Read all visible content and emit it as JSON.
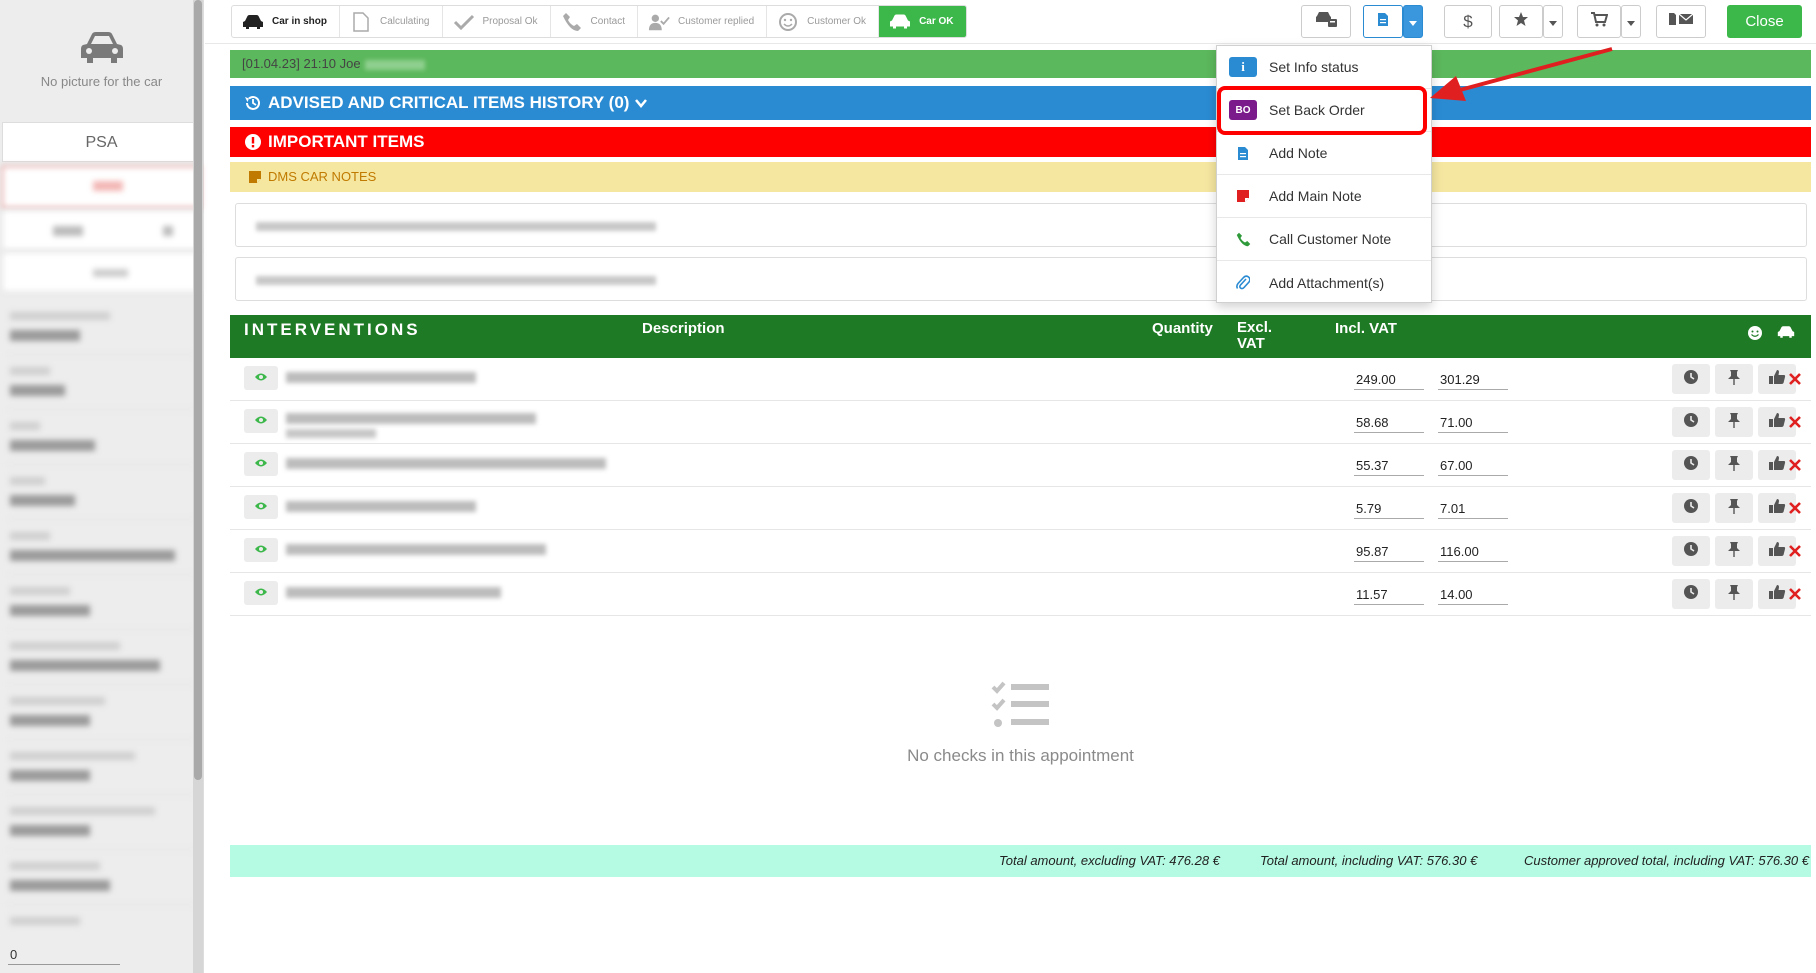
{
  "sidebar": {
    "no_picture_label": "No picture for the car",
    "brand": "PSA",
    "bottom_value": "0"
  },
  "status_steps": [
    {
      "label": "Car in shop",
      "state": "active",
      "icon": "car-icon"
    },
    {
      "label": "Calculating",
      "state": "pending",
      "icon": "document-icon"
    },
    {
      "label": "Proposal Ok",
      "state": "pending",
      "icon": "checkmark-icon"
    },
    {
      "label": "Contact",
      "state": "pending",
      "icon": "phone-icon"
    },
    {
      "label": "Customer replied",
      "state": "pending",
      "icon": "user-check-icon"
    },
    {
      "label": "Customer Ok",
      "state": "pending",
      "icon": "smiley-icon"
    },
    {
      "label": "Car OK",
      "state": "done",
      "icon": "car-icon"
    }
  ],
  "toolbar": {
    "close_label": "Close",
    "dollar_label": "$"
  },
  "notice": {
    "text": "[01.04.23] 21:10 Joe"
  },
  "advised": {
    "title": "ADVISED AND CRITICAL ITEMS HISTORY (0)"
  },
  "important": {
    "title": "IMPORTANT ITEMS"
  },
  "dms": {
    "title": "DMS CAR NOTES"
  },
  "interventions": {
    "title": "INTERVENTIONS",
    "columns": {
      "description": "Description",
      "quantity": "Quantity",
      "excl_vat": "Excl. VAT",
      "incl_vat": "Incl. VAT"
    },
    "rows": [
      {
        "excl": "249.00",
        "incl": "301.29"
      },
      {
        "excl": "58.68",
        "incl": "71.00"
      },
      {
        "excl": "55.37",
        "incl": "67.00"
      },
      {
        "excl": "5.79",
        "incl": "7.01"
      },
      {
        "excl": "95.87",
        "incl": "116.00"
      },
      {
        "excl": "11.57",
        "incl": "14.00"
      }
    ]
  },
  "empty_checks": {
    "text": "No checks in this appointment"
  },
  "totals": {
    "excl": "Total amount, excluding VAT: 476.28 €",
    "incl": "Total amount, including VAT: 576.30 €",
    "approved": "Customer approved total, including VAT: 576.30 €"
  },
  "dropdown": {
    "items": [
      {
        "label": "Set Info status",
        "icon": "info-icon"
      },
      {
        "label": "Set Back Order",
        "badge": "BO",
        "badge_color": "#7b1a8b"
      },
      {
        "label": "Add Note",
        "icon": "note-icon"
      },
      {
        "label": "Add Main Note",
        "icon": "main-note-icon"
      },
      {
        "label": "Call Customer Note",
        "icon": "phone-icon"
      },
      {
        "label": "Add Attachment(s)",
        "icon": "paperclip-icon"
      }
    ]
  },
  "colors": {
    "accent_blue": "#2a8bd3",
    "green": "#3cb84a",
    "dark_green": "#1e7a24",
    "red": "#ff0000",
    "yellow": "#f5e7a0",
    "mint": "#b5fae3"
  }
}
